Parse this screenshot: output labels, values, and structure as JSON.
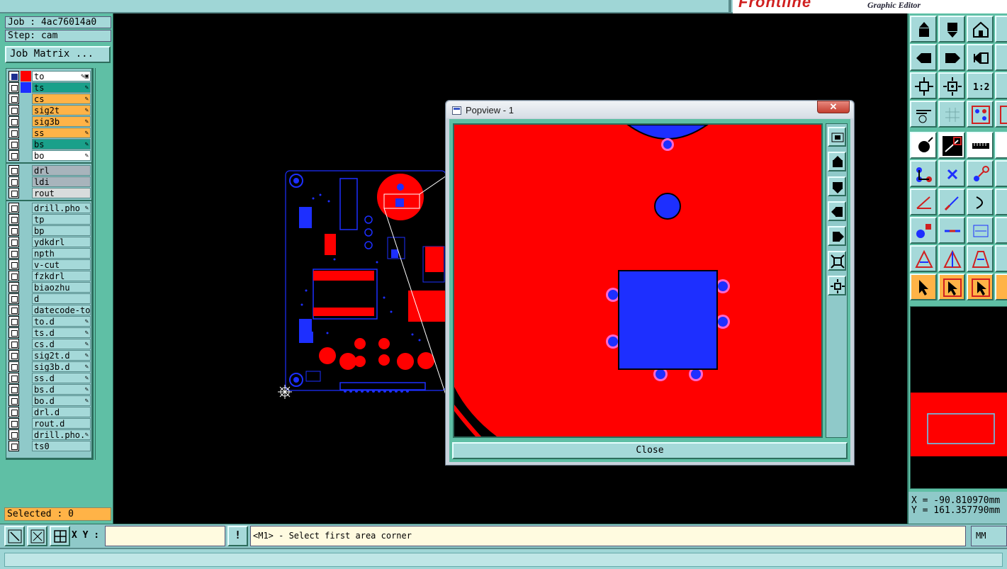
{
  "app": {
    "brand": "Frontline",
    "subtitle": "Graphic Editor"
  },
  "job": {
    "job_label": "Job : 4ac76014a0",
    "step_label": "Step: cam",
    "matrix_button": "Job Matrix ..."
  },
  "layers": [
    {
      "name": "to",
      "color": "#ff0000",
      "bg": "#ffffff",
      "mark": "✎▣",
      "on": true
    },
    {
      "name": "ts",
      "color": "#1d2fff",
      "bg": "#1aa08a",
      "mark": "✎",
      "on": false
    },
    {
      "name": "cs",
      "color": "",
      "bg": "#ffb347",
      "mark": "✎",
      "on": false
    },
    {
      "name": "sig2t",
      "color": "",
      "bg": "#ffb347",
      "mark": "✎",
      "on": false
    },
    {
      "name": "sig3b",
      "color": "",
      "bg": "#ffb347",
      "mark": "✎",
      "on": false
    },
    {
      "name": "ss",
      "color": "",
      "bg": "#ffb347",
      "mark": "✎",
      "on": false
    },
    {
      "name": "bs",
      "color": "",
      "bg": "#1aa08a",
      "mark": "✎",
      "on": false
    },
    {
      "name": "bo",
      "color": "",
      "bg": "#ffffff",
      "mark": "✎",
      "on": false
    },
    {
      "name": "drl",
      "color": "",
      "bg": "#a8b4bc",
      "mark": "",
      "on": false
    },
    {
      "name": "ldi",
      "color": "",
      "bg": "#a8b4bc",
      "mark": "",
      "on": false
    },
    {
      "name": "rout",
      "color": "",
      "bg": "#d8dcdc",
      "mark": "",
      "on": false
    },
    {
      "name": "drill.pho",
      "color": "",
      "bg": "#a5d9d9",
      "mark": "✎",
      "on": false
    },
    {
      "name": "tp",
      "color": "",
      "bg": "#a5d9d9",
      "mark": "",
      "on": false
    },
    {
      "name": "bp",
      "color": "",
      "bg": "#a5d9d9",
      "mark": "",
      "on": false
    },
    {
      "name": "ydkdrl",
      "color": "",
      "bg": "#a5d9d9",
      "mark": "",
      "on": false
    },
    {
      "name": "npth",
      "color": "",
      "bg": "#a5d9d9",
      "mark": "",
      "on": false
    },
    {
      "name": "v-cut",
      "color": "",
      "bg": "#a5d9d9",
      "mark": "",
      "on": false
    },
    {
      "name": "fzkdrl",
      "color": "",
      "bg": "#a5d9d9",
      "mark": "",
      "on": false
    },
    {
      "name": "biaozhu",
      "color": "",
      "bg": "#a5d9d9",
      "mark": "",
      "on": false
    },
    {
      "name": "d",
      "color": "",
      "bg": "#a5d9d9",
      "mark": "",
      "on": false
    },
    {
      "name": "datecode-to",
      "color": "",
      "bg": "#a5d9d9",
      "mark": "",
      "on": false
    },
    {
      "name": "to.d",
      "color": "",
      "bg": "#a5d9d9",
      "mark": "✎",
      "on": false
    },
    {
      "name": "ts.d",
      "color": "",
      "bg": "#a5d9d9",
      "mark": "✎",
      "on": false
    },
    {
      "name": "cs.d",
      "color": "",
      "bg": "#a5d9d9",
      "mark": "✎",
      "on": false
    },
    {
      "name": "sig2t.d",
      "color": "",
      "bg": "#a5d9d9",
      "mark": "✎",
      "on": false
    },
    {
      "name": "sig3b.d",
      "color": "",
      "bg": "#a5d9d9",
      "mark": "✎",
      "on": false
    },
    {
      "name": "ss.d",
      "color": "",
      "bg": "#a5d9d9",
      "mark": "✎",
      "on": false
    },
    {
      "name": "bs.d",
      "color": "",
      "bg": "#a5d9d9",
      "mark": "✎",
      "on": false
    },
    {
      "name": "bo.d",
      "color": "",
      "bg": "#a5d9d9",
      "mark": "✎",
      "on": false
    },
    {
      "name": "drl.d",
      "color": "",
      "bg": "#a5d9d9",
      "mark": "",
      "on": false
    },
    {
      "name": "rout.d",
      "color": "",
      "bg": "#a5d9d9",
      "mark": "",
      "on": false
    },
    {
      "name": "drill.pho.",
      "color": "",
      "bg": "#a5d9d9",
      "mark": "✎",
      "on": false
    },
    {
      "name": "ts0",
      "color": "",
      "bg": "#a5d9d9",
      "mark": "",
      "on": false
    }
  ],
  "selection": {
    "selected_label": "Selected : 0"
  },
  "popview": {
    "title": "Popview - 1",
    "close_x": "✕",
    "close_button": "Close"
  },
  "coordinates": {
    "x": "X = -90.810970mm",
    "y": "Y = 161.357790mm"
  },
  "bottom": {
    "xy_label": "X Y :",
    "xy_value": "",
    "info_button": "!",
    "prompt": "<M1> - Select first area corner",
    "units": "MM"
  },
  "colors": {
    "panel": "#5fbfa5",
    "field": "#a5d9d9",
    "layer_top": "#ff0000",
    "layer_solder": "#1d2fff",
    "highlight": "#ffb347"
  }
}
